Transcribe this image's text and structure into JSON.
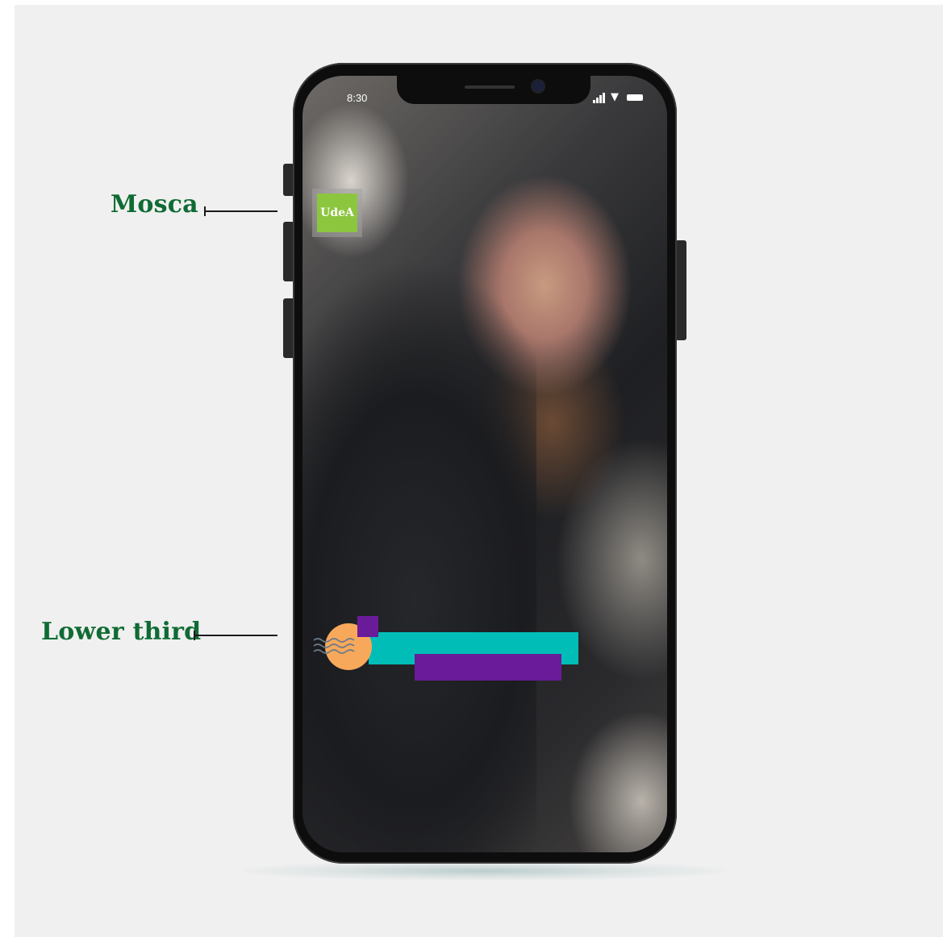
{
  "callouts": {
    "mosca_label": "Mosca",
    "lower_third_label": "Lower third"
  },
  "status_bar": {
    "time": "8:30",
    "icons": [
      "signal-icon",
      "wifi-icon",
      "battery-icon"
    ]
  },
  "mosca": {
    "logo_text": "UdeA"
  },
  "colors": {
    "callout_text": "#0f6b34",
    "logo_green": "#8cc63f",
    "lower_third_teal": "#00bdb8",
    "lower_third_purple": "#6a1b9a",
    "lower_third_orange": "#f7a85b"
  }
}
